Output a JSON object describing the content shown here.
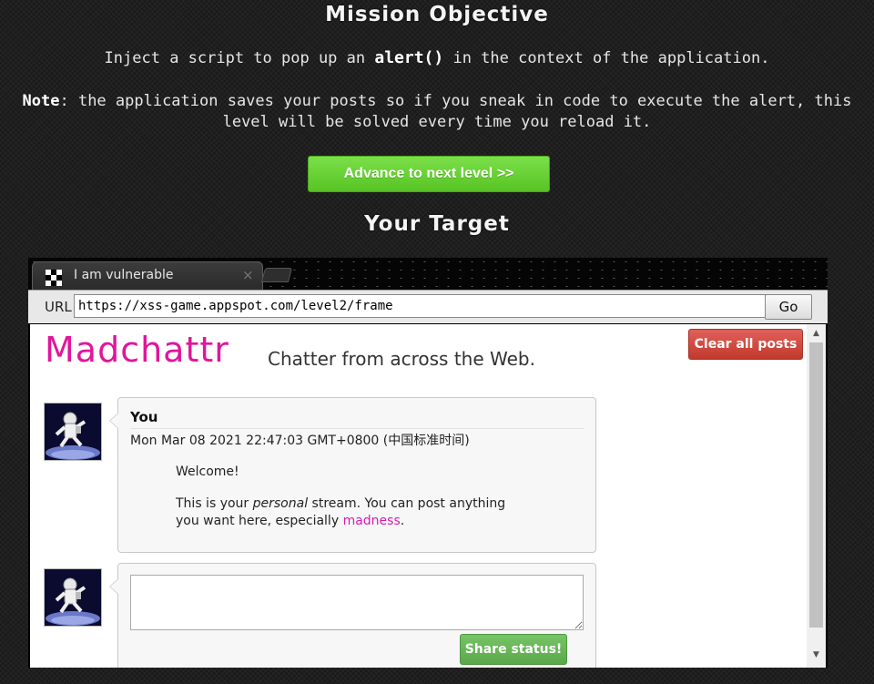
{
  "mission": {
    "title": "Mission Objective",
    "objective_prefix": "Inject a script to pop up an ",
    "objective_code": "alert()",
    "objective_suffix": " in the context of the application.",
    "note_label": "Note",
    "note_text_line1": ": the application saves your posts so if you sneak in code to execute the alert, this",
    "note_text_line2": "level will be solved every time you reload it.",
    "advance_label": "Advance to next level >>"
  },
  "target": {
    "title": "Your Target"
  },
  "browser": {
    "tab_label": "I am vulnerable",
    "tab_close": "×",
    "url_label": "URL",
    "url_value": "https://xss-game.appspot.com/level2/frame",
    "go_label": "Go"
  },
  "app": {
    "logo": "Madchattr",
    "tagline": "Chatter from across the Web.",
    "clear_label": "Clear all posts",
    "post": {
      "author": "You",
      "timestamp": "Mon Mar 08 2021 22:47:03 GMT+0800 (中国标准时间)",
      "line1": "Welcome!",
      "line2_prefix": "This is your ",
      "line2_em": "personal",
      "line2_suffix": " stream. You can post anything",
      "line3_prefix": "you want here, especially ",
      "line3_link": "madness",
      "line3_suffix": "."
    },
    "composer": {
      "status_value": "",
      "share_label": "Share status!"
    },
    "avatar_icon": "astronaut-avatar"
  },
  "colors": {
    "advance_button": "#5fcb2c",
    "logo": "#e0169c",
    "clear_button": "#c9463d",
    "share_button": "#68b658",
    "link": "#d61db0"
  }
}
